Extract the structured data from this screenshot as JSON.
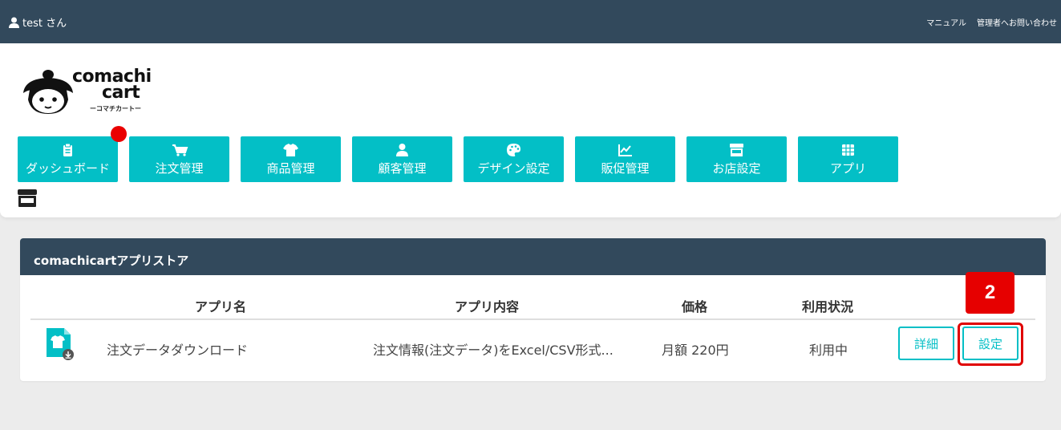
{
  "topbar": {
    "user_label": "test さん",
    "links": [
      "マニュアル",
      "管理者へお問い合わせ"
    ]
  },
  "logo": {
    "line1": "comachi",
    "line2": "cart",
    "sub": "ーコマチカートー"
  },
  "nav": [
    {
      "label": "ダッシュボード",
      "icon": "clipboard-icon"
    },
    {
      "label": "注文管理",
      "icon": "cart-icon"
    },
    {
      "label": "商品管理",
      "icon": "tshirt-icon"
    },
    {
      "label": "顧客管理",
      "icon": "user-icon"
    },
    {
      "label": "デザイン設定",
      "icon": "palette-icon"
    },
    {
      "label": "販促管理",
      "icon": "chart-line-icon"
    },
    {
      "label": "お店設定",
      "icon": "store-icon"
    },
    {
      "label": "アプリ",
      "icon": "grid-icon"
    }
  ],
  "store": {
    "title": "comachicartアプリストア",
    "columns": [
      "アプリ名",
      "アプリ内容",
      "価格",
      "利用状況"
    ],
    "rows": [
      {
        "name": "注文データダウンロード",
        "description": "注文情報(注文データ)をExcel/CSV形式...",
        "price": "月額 220円",
        "status": "利用中",
        "detail_label": "詳細",
        "settings_label": "設定"
      }
    ]
  },
  "annotation": {
    "step": "2"
  },
  "colors": {
    "topbar": "#32495c",
    "accent": "#03bfc6",
    "highlight": "#e60000"
  }
}
